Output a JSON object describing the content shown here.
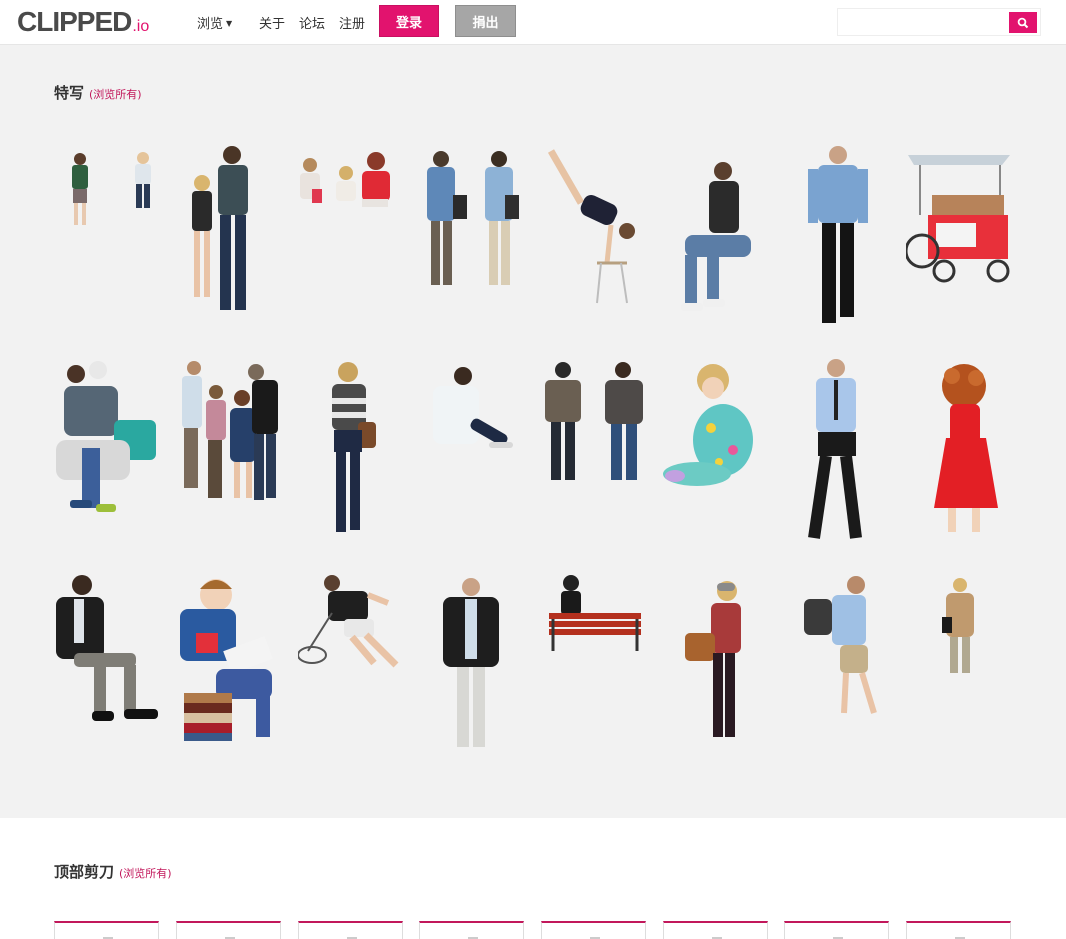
{
  "header": {
    "logo_main": "CLIPPED",
    "logo_suffix": ".io",
    "nav": [
      {
        "label": "浏览",
        "has_dropdown": true
      },
      {
        "label": "关于"
      },
      {
        "label": "论坛"
      },
      {
        "label": "注册"
      }
    ],
    "login_label": "登录",
    "donate_label": "捐出",
    "search": {
      "value": "",
      "placeholder": "",
      "icon": "search-icon"
    }
  },
  "featured": {
    "title": "特写",
    "browse_all": "(浏览所有)",
    "items": [
      {
        "subject": "two small children"
      },
      {
        "subject": "couple walking"
      },
      {
        "subject": "three girls sitting"
      },
      {
        "subject": "two men with shoulder bags"
      },
      {
        "subject": "gymnast on bar"
      },
      {
        "subject": "woman crouching"
      },
      {
        "subject": "man in blue shirt walking away"
      },
      {
        "subject": "red vending cart"
      },
      {
        "subject": "mother holding child"
      },
      {
        "subject": "group of four talking"
      },
      {
        "subject": "woman with handbag walking"
      },
      {
        "subject": "man sitting on ground"
      },
      {
        "subject": "two men standing"
      },
      {
        "subject": "girl sitting in floral dress"
      },
      {
        "subject": "man checking phone"
      },
      {
        "subject": "girl in red dress"
      },
      {
        "subject": "man sitting"
      },
      {
        "subject": "boy reading on books"
      },
      {
        "subject": "tennis player"
      },
      {
        "subject": "man in blazer walking"
      },
      {
        "subject": "person on red bench"
      },
      {
        "subject": "woman with brown bag"
      },
      {
        "subject": "man with backpack"
      },
      {
        "subject": "woman in trench coat"
      }
    ]
  },
  "top_clippers": {
    "title": "顶部剪刀",
    "browse_all": "(浏览所有)",
    "cards": [
      {},
      {},
      {},
      {},
      {},
      {},
      {},
      {}
    ]
  },
  "colors": {
    "accent": "#e2136e",
    "featured_bg": "#f2f2f2",
    "donate": "#a6a6a6"
  }
}
